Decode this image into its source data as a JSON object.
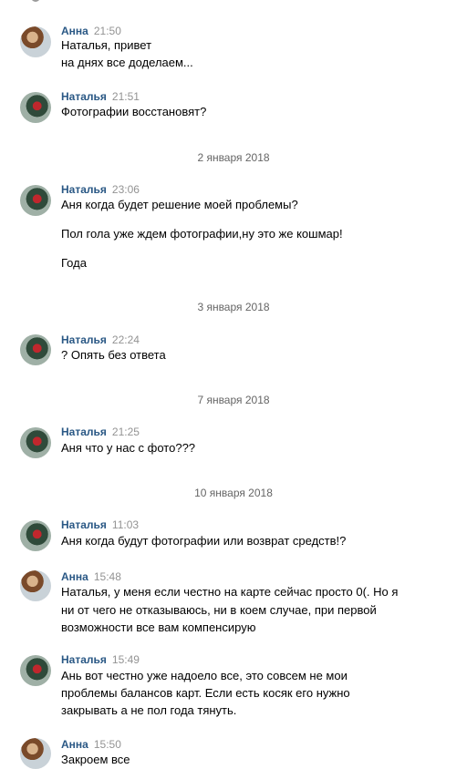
{
  "messages": [
    {
      "author": "Анна",
      "time": "21:50",
      "lines": [
        "Наталья, привет",
        "на днях все доделаем..."
      ]
    },
    {
      "author": "Наталья",
      "time": "21:51",
      "lines": [
        "Фотографии восстановят?"
      ]
    },
    {
      "author": "Наталья",
      "time": "23:06",
      "lines": [
        "Аня когда будет решение моей проблемы?",
        "Пол гола уже ждем фотографии,ну это же кошмар!",
        "Года"
      ]
    },
    {
      "author": "Наталья",
      "time": "22:24",
      "lines": [
        "? Опять без ответа"
      ]
    },
    {
      "author": "Наталья",
      "time": "21:25",
      "lines": [
        "Аня что у нас с фото???"
      ]
    },
    {
      "author": "Наталья",
      "time": "11:03",
      "lines": [
        "Аня когда будут фотографии или возврат средств!?"
      ]
    },
    {
      "author": "Анна",
      "time": "15:48",
      "lines": [
        "Наталья, у меня если честно на карте сейчас просто 0(. Но я",
        "ни от чего не отказываюсь, ни в коем случае, при первой",
        "возможности все вам компенсирую"
      ]
    },
    {
      "author": "Наталья",
      "time": "15:49",
      "lines": [
        "Ань вот честно уже надоело все, это совсем не мои",
        "проблемы балансов карт. Если есть косяк его нужно",
        "закрывать а не пол года тянуть."
      ]
    },
    {
      "author": "Анна",
      "time": "15:50",
      "lines": [
        "Закроем все"
      ]
    }
  ],
  "dates": [
    "2 января 2018",
    "3 января 2018",
    "7 января 2018",
    "10 января 2018"
  ]
}
